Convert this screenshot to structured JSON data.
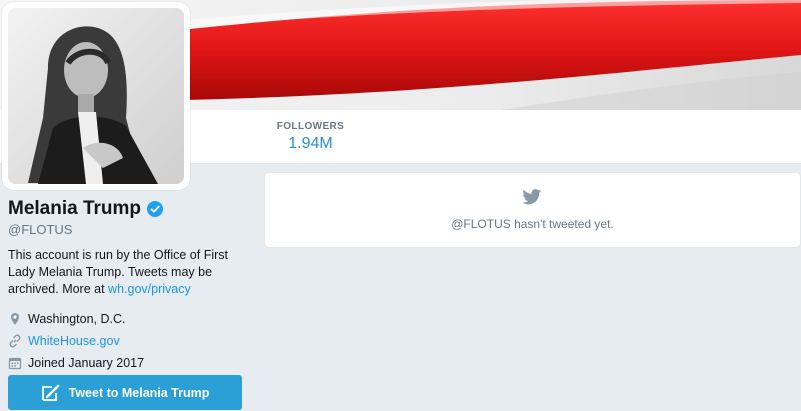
{
  "profile": {
    "name": "Melania Trump",
    "handle": "@FLOTUS",
    "bio_text": "This account is run by the Office of First Lady Melania Trump. Tweets may be archived. More at ",
    "bio_link": "wh.gov/privacy",
    "location": "Washington, D.C.",
    "website": "WhiteHouse.gov",
    "joined": "Joined January 2017"
  },
  "stats": {
    "followers_label": "FOLLOWERS",
    "followers_value": "1.94M"
  },
  "timeline": {
    "empty_text": "@FLOTUS hasn't tweeted yet."
  },
  "tweet_button": {
    "label": "Tweet to Melania Trump"
  },
  "colors": {
    "accent": "#1da1f2",
    "button": "#2aa0d6",
    "banner_red": "#e21a1a"
  },
  "icons": [
    "verified-badge-icon",
    "location-pin-icon",
    "link-icon",
    "calendar-icon",
    "twitter-bird-icon",
    "compose-tweet-icon"
  ]
}
